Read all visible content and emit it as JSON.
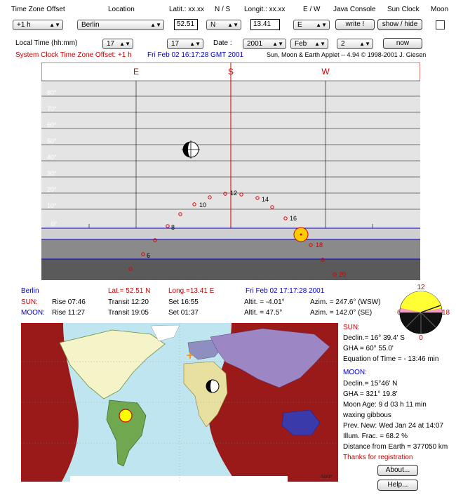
{
  "header": {
    "tz_label": "Time Zone Offset",
    "location_label": "Location",
    "lat_label": "Latit.: xx.xx",
    "ns_label": "N / S",
    "long_label": "Longit.: xx.xx",
    "ew_label": "E / W",
    "java_label": "Java Console",
    "sunclock_label": "Sun Clock",
    "moon_label": "Moon"
  },
  "controls": {
    "tz_value": "+1 h",
    "location_value": "Berlin",
    "lat_value": "52.51",
    "ns_value": "N",
    "long_value": "13.41",
    "ew_value": "E",
    "write_button": "write !",
    "showhide_button": "show / hide",
    "localtime_label": "Local Time (hh:mm)",
    "hour_value": "17",
    "minute_value": "17",
    "date_label": "Date :",
    "year_value": "2001",
    "month_value": "Feb",
    "day_value": "2",
    "now_button": "now"
  },
  "status": {
    "sysclock": "System Clock Time Zone Offset: +1 h",
    "gmt": "Fri Feb 02 16:17:28 GMT 2001",
    "applet": "Sun, Moon & Earth Applet -- 4.94  © 1998-2001 J. Giesen"
  },
  "sky_chart": {
    "directions": [
      "E",
      "S",
      "W"
    ],
    "alt_ticks": [
      "80°",
      "70°",
      "60°",
      "50°",
      "40°",
      "30°",
      "20°",
      "10°",
      "0°"
    ],
    "hour_labels": [
      "6",
      "8",
      "10",
      "12",
      "14",
      "16",
      "18",
      "20"
    ]
  },
  "info": {
    "city": "Berlin",
    "lat": "Lat.= 52.51 N",
    "long": "Long.=13.41 E",
    "datetime": "Fri Feb 02   17:17:28  2001",
    "sun_label": "SUN:",
    "sun_rise": "Rise   07:46",
    "sun_transit": "Transit  12:20",
    "sun_set": "Set     16:55",
    "sun_altit": "Altit. = -4.01°",
    "sun_azim": "Azim. = 247.6° (WSW)",
    "moon_label": "MOON:",
    "moon_rise": "Rise   11:27",
    "moon_transit": "Transit  19:05",
    "moon_set": "Set     01:37",
    "moon_altit": "Altit. = 47.5°",
    "moon_azim": "Azim. = 142.0° (SE)"
  },
  "clock": {
    "top": "12",
    "left": "6",
    "right": "18",
    "bottom": "0"
  },
  "side": {
    "sun_title": "SUN:",
    "sun_declin": "Declin.= 16° 39.4' S",
    "sun_gha": "GHA    = 60° 55.0'",
    "sun_eqtime": "Equation of Time = - 13:46 min",
    "moon_title": "MOON:",
    "moon_declin": "Declin.= 15°46' N",
    "moon_gha": "GHA    = 321° 19.8'",
    "moon_age": "Moon Age: 9 d 03 h 11 min",
    "moon_phase": "waxing gibbous",
    "prev_new": "Prev. New:  Wed Jan 24 at 14:07",
    "illum": "Illum. Frac. = 68.2 %",
    "distance": "Distance from Earth = 377050 km",
    "thanks": "Thanks for registration",
    "about_button": "About...",
    "help_button": "Help..."
  },
  "map": {
    "watermark": "MAP"
  }
}
